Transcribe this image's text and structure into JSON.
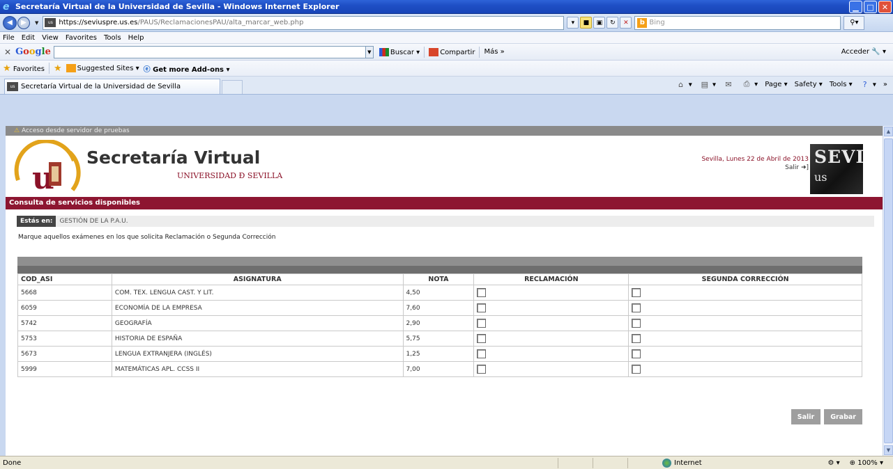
{
  "window": {
    "title": "Secretaría Virtual de la Universidad de Sevilla - Windows Internet Explorer",
    "controls": [
      "minimize-icon",
      "maximize-icon",
      "close-icon"
    ]
  },
  "addressbar": {
    "url_domain": "https://seviuspre.us.es",
    "url_path": "/PAUS/ReclamacionesPAU/alta_marcar_web.php",
    "search_placeholder": "Bing"
  },
  "menu": {
    "items": [
      "File",
      "Edit",
      "View",
      "Favorites",
      "Tools",
      "Help"
    ]
  },
  "google_toolbar": {
    "logo": "Google",
    "buscar": "Buscar",
    "compartir": "Compartir",
    "mas": "Más »",
    "acceder": "Acceder"
  },
  "favorites_bar": {
    "favorites": "Favorites",
    "suggested": "Suggested Sites",
    "addons": "Get more Add-ons"
  },
  "tab": {
    "title": "Secretaría Virtual de la Universidad de Sevilla"
  },
  "command_bar": {
    "page": "Page",
    "safety": "Safety",
    "tools": "Tools"
  },
  "page": {
    "warning": "Acceso desde servidor de pruebas",
    "brand": "Secretaría Virtual",
    "university": "UNIVERSIDAD Ð SEVILLA",
    "date": "Sevilla, Lunes 22 de Abril de 2013",
    "salir_top": "Salir",
    "logo_top": "SEVI",
    "logo_bottom": "us",
    "section": "Consulta de servicios disponibles",
    "breadcrumb_label": "Estás en:",
    "breadcrumb_value": "GESTIÓN DE LA P.A.U.",
    "instructions": "Marque aquellos exámenes en los que solicita Reclamación o Segunda Corrección"
  },
  "table": {
    "headers": [
      "COD_ASI",
      "ASIGNATURA",
      "NOTA",
      "RECLAMACIÓN",
      "SEGUNDA CORRECCIÓN"
    ],
    "rows": [
      {
        "cod": "5668",
        "asignatura": "COM. TEX. LENGUA CAST. Y LIT.",
        "nota": "4,50",
        "reclamacion": false,
        "segunda": false
      },
      {
        "cod": "6059",
        "asignatura": "ECONOMÍA DE LA EMPRESA",
        "nota": "7,60",
        "reclamacion": false,
        "segunda": false
      },
      {
        "cod": "5742",
        "asignatura": "GEOGRAFÍA",
        "nota": "2,90",
        "reclamacion": false,
        "segunda": false
      },
      {
        "cod": "5753",
        "asignatura": "HISTORIA DE ESPAÑA",
        "nota": "5,75",
        "reclamacion": false,
        "segunda": false
      },
      {
        "cod": "5673",
        "asignatura": "LENGUA EXTRANJERA (INGLÉS)",
        "nota": "1,25",
        "reclamacion": false,
        "segunda": false
      },
      {
        "cod": "5999",
        "asignatura": "MATEMÁTICAS APL. CCSS II",
        "nota": "7,00",
        "reclamacion": false,
        "segunda": false
      }
    ]
  },
  "actions": {
    "salir": "Salir",
    "grabar": "Grabar"
  },
  "status": {
    "left": "Done",
    "zone": "Internet",
    "zoom": "100%"
  }
}
